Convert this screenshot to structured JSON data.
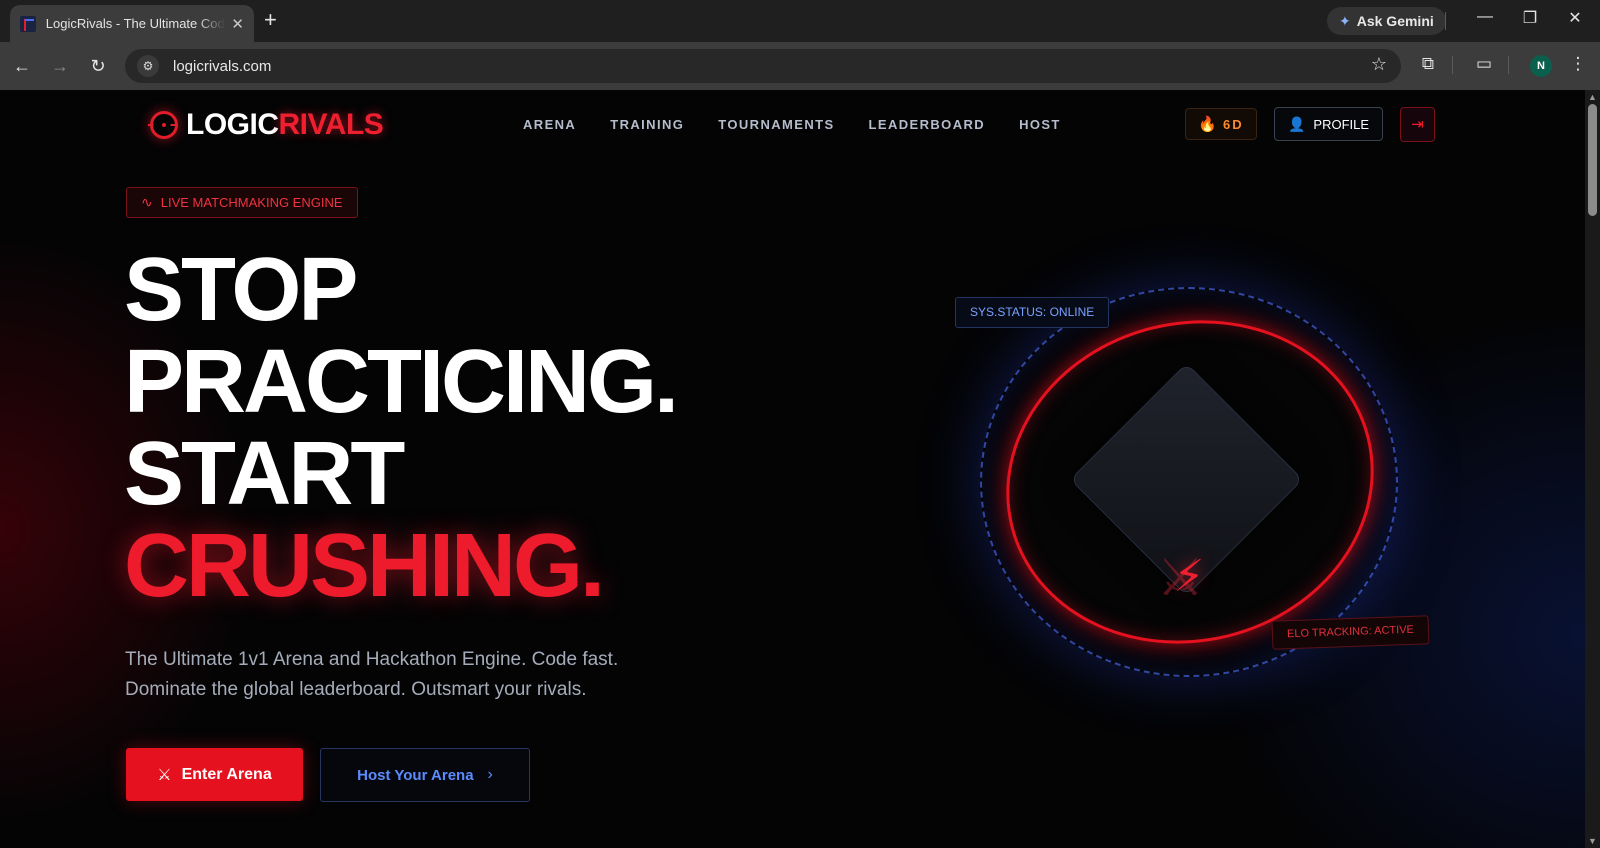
{
  "browser": {
    "tab_title": "LogicRivals - The Ultimate Codi",
    "tab_close": "✕",
    "new_tab": "+",
    "ask_gemini": "Ask Gemini",
    "url": "logicrivals.com",
    "profile_initial": "N"
  },
  "site": {
    "logo_part1": "LOGIC",
    "logo_part2": "RIVALS",
    "nav": [
      "ARENA",
      "TRAINING",
      "TOURNAMENTS",
      "LEADERBOARD",
      "HOST"
    ],
    "streak": "6D",
    "profile_label": "PROFILE"
  },
  "hero": {
    "badge": "LIVE MATCHMAKING ENGINE",
    "headline_line1": "STOP",
    "headline_line2": "PRACTICING.",
    "headline_line3": "START",
    "headline_line4": "CRUSHING.",
    "subtitle": "The Ultimate 1v1 Arena and Hackathon Engine. Code fast. Dominate the global leaderboard. Outsmart your rivals.",
    "enter_button": "Enter Arena",
    "host_button": "Host Your Arena"
  },
  "visual": {
    "status_tag": "SYS.STATUS: ONLINE",
    "elo_tag": "ELO TRACKING: ACTIVE"
  },
  "colors": {
    "accent_red": "#e5111f",
    "accent_blue": "#5b8cff",
    "streak_orange": "#ff8a2a",
    "background": "#040405"
  },
  "icons": {
    "badge": "pulse-icon",
    "streak": "flame-icon",
    "profile": "user-icon",
    "logout": "logout-icon",
    "enter": "crossed-swords-icon",
    "host": "chevron-right-icon",
    "center": "lightning-bolt-icon"
  }
}
